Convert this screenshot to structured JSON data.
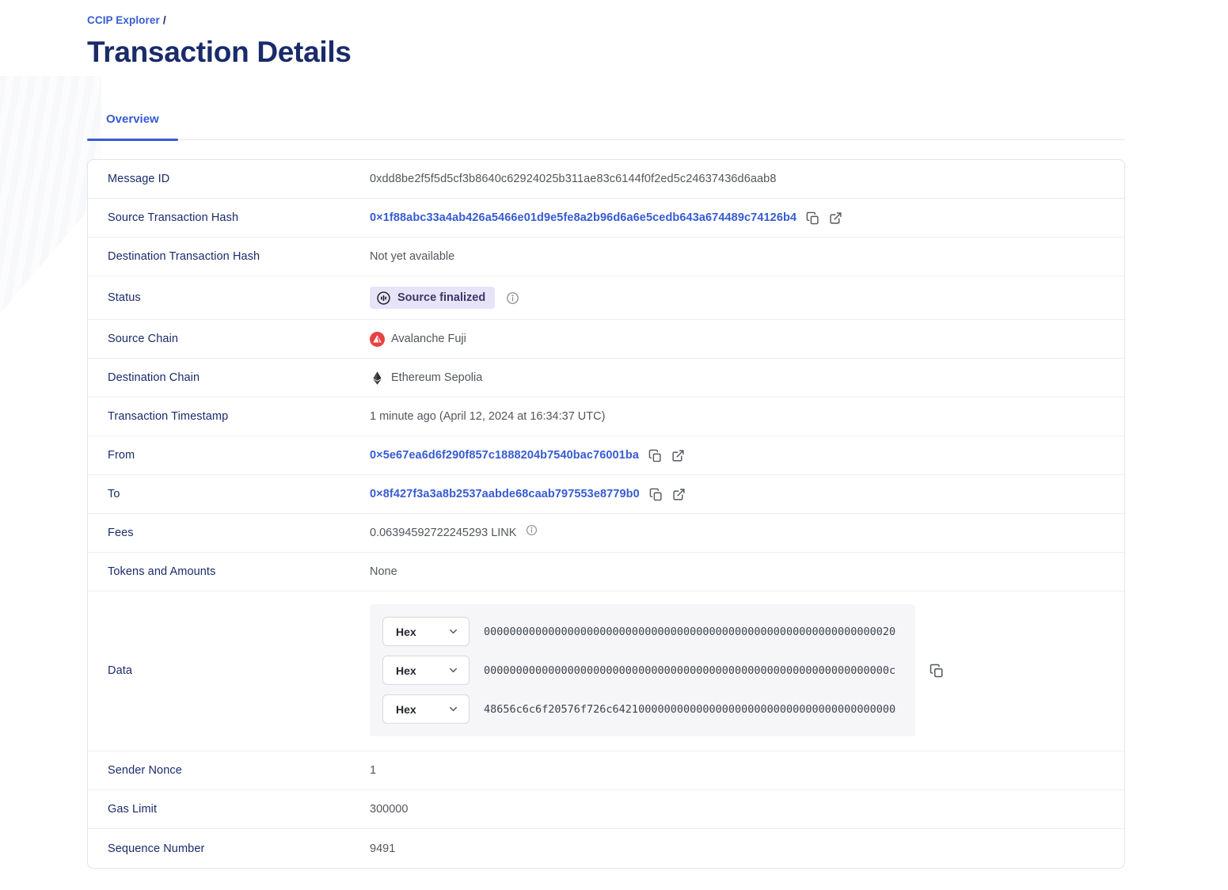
{
  "breadcrumb": {
    "label": "CCIP Explorer",
    "separator": "/"
  },
  "page": {
    "title": "Transaction Details"
  },
  "tabs": {
    "overview": "Overview"
  },
  "rows": {
    "message_id": {
      "label": "Message ID",
      "value": "0xdd8be2f5f5d5cf3b8640c62924025b311ae83c6144f0f2ed5c24637436d6aab8"
    },
    "source_tx_hash": {
      "label": "Source Transaction Hash",
      "value": "0×1f88abc33a4ab426a5466e01d9e5fe8a2b96d6a6e5cedb643a674489c74126b4"
    },
    "dest_tx_hash": {
      "label": "Destination Transaction Hash",
      "value": "Not yet available"
    },
    "status": {
      "label": "Status",
      "badge": "Source finalized"
    },
    "source_chain": {
      "label": "Source Chain",
      "value": "Avalanche Fuji"
    },
    "dest_chain": {
      "label": "Destination Chain",
      "value": "Ethereum Sepolia"
    },
    "timestamp": {
      "label": "Transaction Timestamp",
      "value": "1 minute ago (April 12, 2024 at 16:34:37 UTC)"
    },
    "from": {
      "label": "From",
      "value": "0×5e67ea6d6f290f857c1888204b7540bac76001ba"
    },
    "to": {
      "label": "To",
      "value": "0×8f427f3a3a8b2537aabde68caab797553e8779b0"
    },
    "fees": {
      "label": "Fees",
      "value": "0.06394592722245293 LINK"
    },
    "tokens": {
      "label": "Tokens and Amounts",
      "value": "None"
    },
    "data": {
      "label": "Data",
      "format_selector": "Hex",
      "lines": [
        "0000000000000000000000000000000000000000000000000000000000000020",
        "000000000000000000000000000000000000000000000000000000000000000c",
        "48656c6c6f20576f726c64210000000000000000000000000000000000000000"
      ]
    },
    "sender_nonce": {
      "label": "Sender Nonce",
      "value": "1"
    },
    "gas_limit": {
      "label": "Gas Limit",
      "value": "300000"
    },
    "sequence_number": {
      "label": "Sequence Number",
      "value": "9491"
    }
  },
  "colors": {
    "accent_blue": "#375bd2",
    "navy": "#1a2b6b",
    "badge_bg": "#e7e4f9",
    "avalanche_red": "#e84142",
    "ethereum_dark": "#2b2b2b"
  }
}
